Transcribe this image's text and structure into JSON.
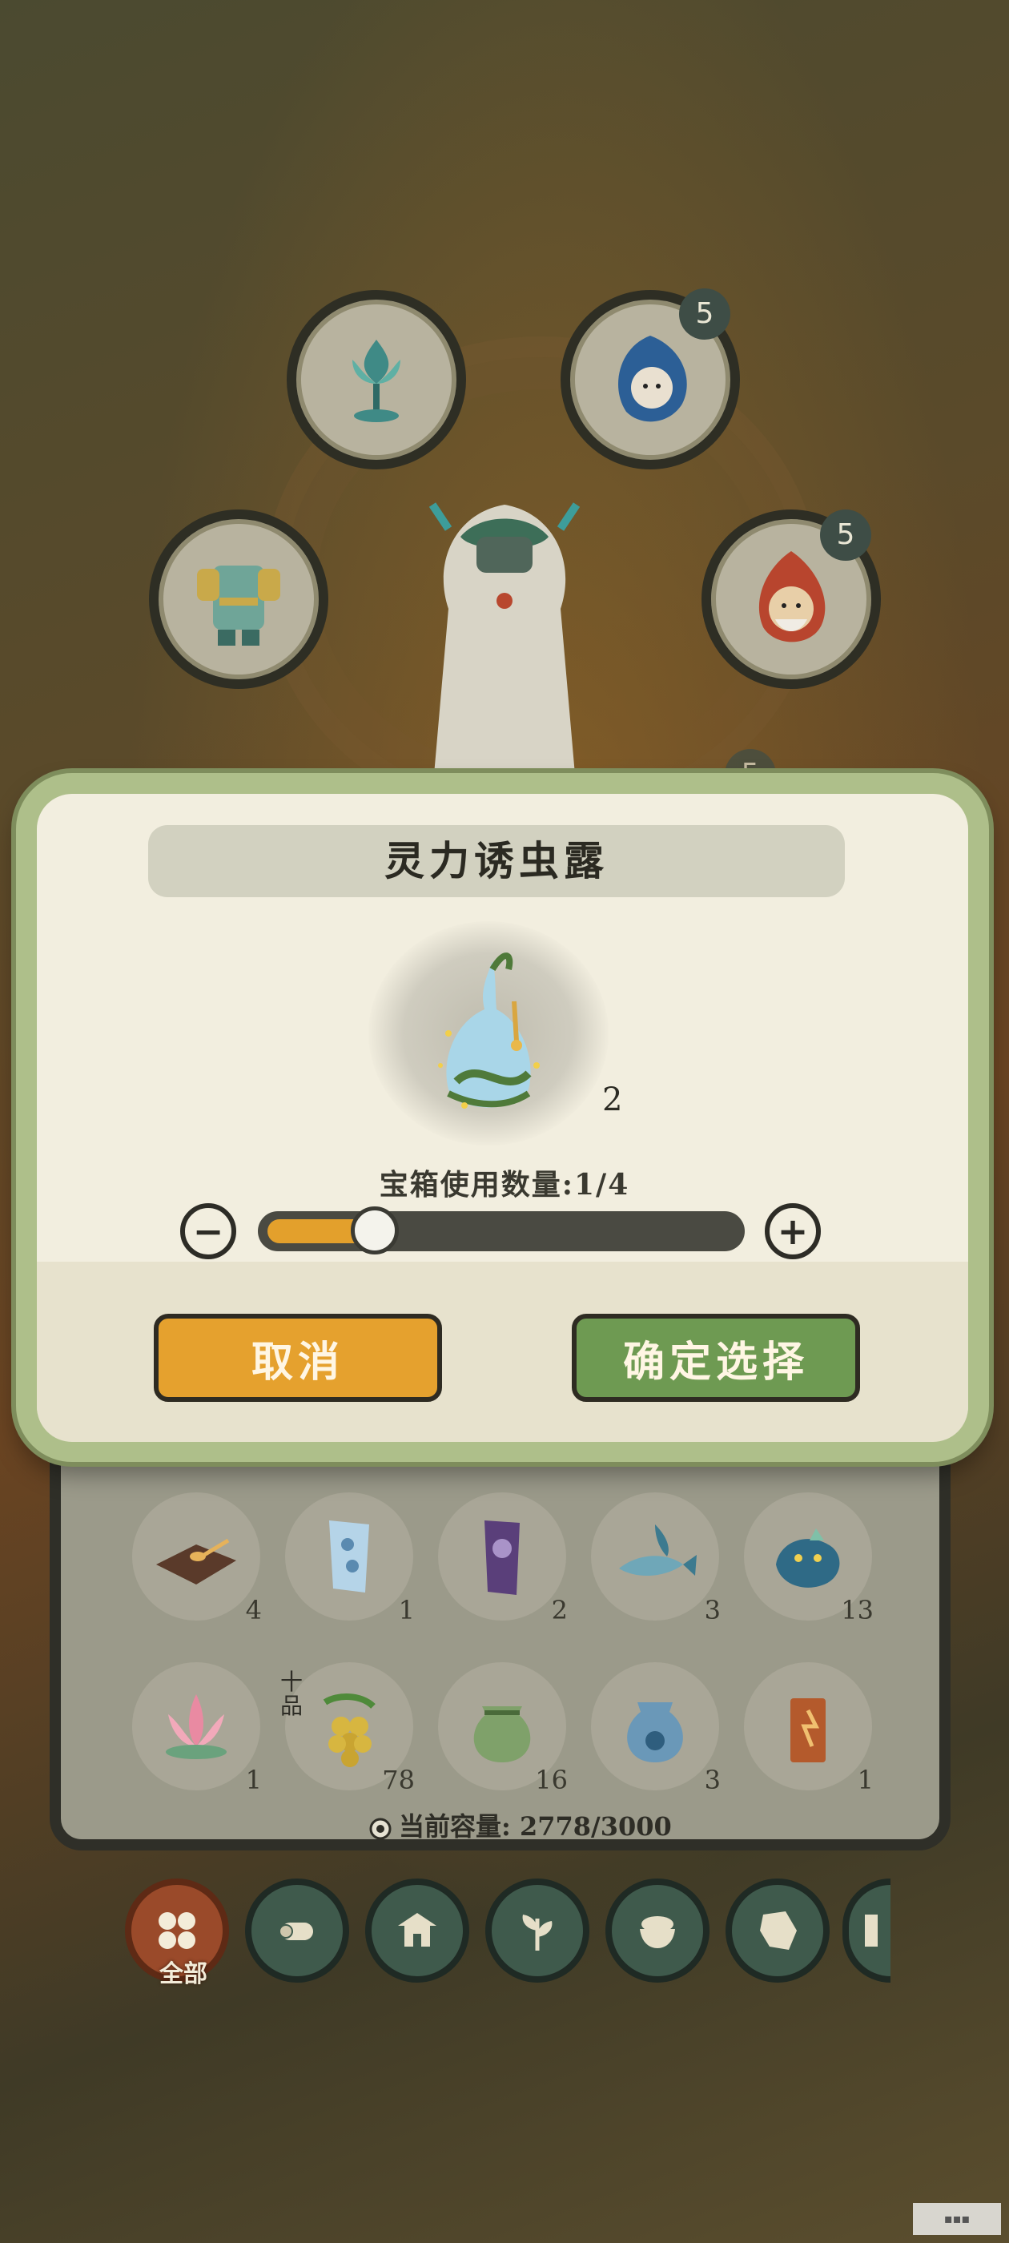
{
  "scene": {
    "slots": [
      {
        "name": "lotus-goblet-icon",
        "badge": ""
      },
      {
        "name": "blue-spirit-icon",
        "badge": "5"
      },
      {
        "name": "armor-icon",
        "badge": ""
      },
      {
        "name": "fire-elder-icon",
        "badge": "5"
      }
    ],
    "hidden_badge": "5"
  },
  "dialog": {
    "title": "灵力诱虫露",
    "item_count": "2",
    "use_count_text": "宝箱使用数量:1/4",
    "use_current": 1,
    "use_max": 4,
    "cancel_label": "取消",
    "confirm_label": "确定选择"
  },
  "inventory": {
    "items": [
      {
        "icon": "tray-spoon-icon",
        "count": "4"
      },
      {
        "icon": "blue-scroll-icon",
        "count": "1"
      },
      {
        "icon": "purple-scroll-icon",
        "count": "2"
      },
      {
        "icon": "fish-icon",
        "count": "3"
      },
      {
        "icon": "spirit-beast-icon",
        "count": "13"
      },
      {
        "icon": "lotus-icon",
        "count": "1"
      },
      {
        "icon": "golden-grape-icon",
        "count": "78",
        "grade": "十品"
      },
      {
        "icon": "green-pouch-icon",
        "count": "16"
      },
      {
        "icon": "blue-pouch-icon",
        "count": "3"
      },
      {
        "icon": "talisman-icon",
        "count": "1"
      }
    ],
    "capacity": "当前容量: 2778/3000"
  },
  "categories": [
    {
      "icon": "all-icon",
      "label": "全部",
      "active": true
    },
    {
      "icon": "log-icon",
      "label": ""
    },
    {
      "icon": "house-icon",
      "label": ""
    },
    {
      "icon": "herb-icon",
      "label": ""
    },
    {
      "icon": "bowl-icon",
      "label": ""
    },
    {
      "icon": "ore-icon",
      "label": ""
    },
    {
      "icon": "scroll-icon",
      "label": ""
    }
  ],
  "colors": {
    "accent_orange": "#e5a12e",
    "accent_green": "#6e9a52",
    "frame": "#aebf8a"
  }
}
